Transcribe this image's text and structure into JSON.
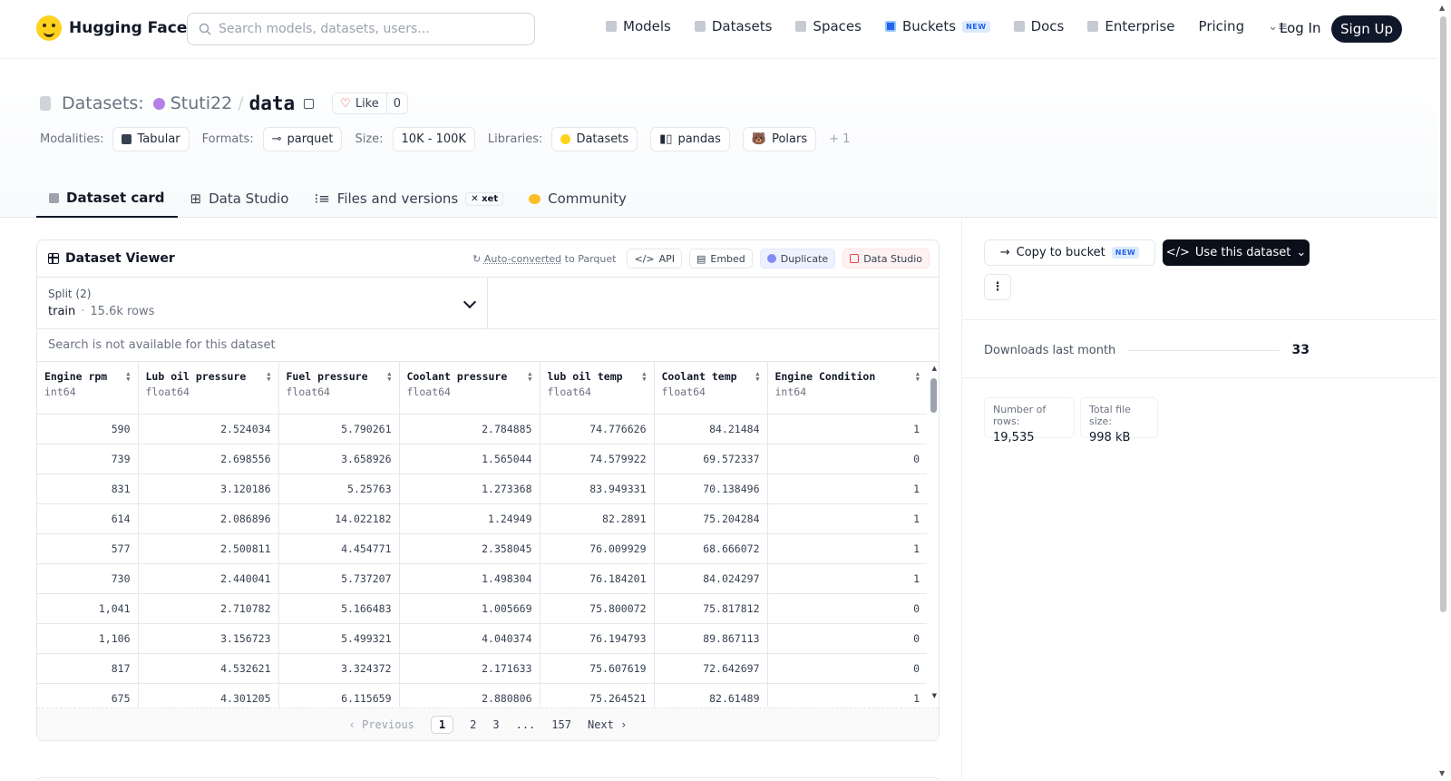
{
  "header": {
    "brand": "Hugging Face",
    "search_placeholder": "Search models, datasets, users...",
    "nav": [
      {
        "label": "Models",
        "icon": "cube-icon"
      },
      {
        "label": "Datasets",
        "icon": "database-icon"
      },
      {
        "label": "Spaces",
        "icon": "grid-icon"
      },
      {
        "label": "Buckets",
        "icon": "bucket-icon",
        "badge": "NEW"
      },
      {
        "label": "Docs",
        "icon": "book-icon"
      },
      {
        "label": "Enterprise",
        "icon": "building-icon"
      },
      {
        "label": "Pricing"
      }
    ],
    "login": "Log In",
    "signup": "Sign Up"
  },
  "dataset": {
    "prefix": "Datasets:",
    "owner": "Stuti22",
    "slash": "/",
    "name": "data",
    "like_label": "Like",
    "like_count": "0",
    "modalities_label": "Modalities:",
    "modality": "Tabular",
    "formats_label": "Formats:",
    "format": "parquet",
    "size_label": "Size:",
    "size": "10K - 100K",
    "libraries_label": "Libraries:",
    "libraries": [
      "Datasets",
      "pandas",
      "Polars"
    ],
    "more_libraries": "+ 1"
  },
  "tabs": {
    "card": "Dataset card",
    "studio": "Data Studio",
    "files": "Files and versions",
    "xet": "xet",
    "community": "Community"
  },
  "viewer": {
    "title": "Dataset Viewer",
    "autoconv_link": "Auto-converted",
    "autoconv_rest": " to Parquet",
    "api": "API",
    "embed": "Embed",
    "duplicate": "Duplicate",
    "data_studio": "Data Studio",
    "split_label": "Split (2)",
    "split_value": "train",
    "split_sep": "·",
    "split_rows": "15.6k rows",
    "search_na": "Search is not available for this dataset",
    "columns": [
      {
        "name": "Engine rpm",
        "dtype": "int64"
      },
      {
        "name": "Lub oil pressure",
        "dtype": "float64"
      },
      {
        "name": "Fuel pressure",
        "dtype": "float64"
      },
      {
        "name": "Coolant pressure",
        "dtype": "float64"
      },
      {
        "name": "lub oil temp",
        "dtype": "float64"
      },
      {
        "name": "Coolant temp",
        "dtype": "float64"
      },
      {
        "name": "Engine Condition",
        "dtype": "int64"
      }
    ],
    "rows": [
      [
        "590",
        "2.524034",
        "5.790261",
        "2.784885",
        "74.776626",
        "84.21484",
        "1"
      ],
      [
        "739",
        "2.698556",
        "3.658926",
        "1.565044",
        "74.579922",
        "69.572337",
        "0"
      ],
      [
        "831",
        "3.120186",
        "5.25763",
        "1.273368",
        "83.949331",
        "70.138496",
        "1"
      ],
      [
        "614",
        "2.086896",
        "14.022182",
        "1.24949",
        "82.2891",
        "75.204284",
        "1"
      ],
      [
        "577",
        "2.500811",
        "4.454771",
        "2.358045",
        "76.009929",
        "68.666072",
        "1"
      ],
      [
        "730",
        "2.440041",
        "5.737207",
        "1.498304",
        "76.184201",
        "84.024297",
        "1"
      ],
      [
        "1,041",
        "2.710782",
        "5.166483",
        "1.005669",
        "75.800072",
        "75.817812",
        "0"
      ],
      [
        "1,106",
        "3.156723",
        "5.499321",
        "4.040374",
        "76.194793",
        "89.867113",
        "0"
      ],
      [
        "817",
        "4.532621",
        "3.324372",
        "2.171633",
        "75.607619",
        "72.642697",
        "0"
      ],
      [
        "675",
        "4.301205",
        "6.115659",
        "2.880806",
        "75.264521",
        "82.61489",
        "1"
      ]
    ],
    "pager": {
      "prev": "Previous",
      "pages": [
        "1",
        "2",
        "3",
        "...",
        "157"
      ],
      "next": "Next"
    }
  },
  "sidebar": {
    "copy_bucket": "Copy to bucket",
    "copy_badge": "NEW",
    "use_dataset": "Use this dataset",
    "downloads_label": "Downloads last month",
    "downloads": "33",
    "rows_label": "Number of rows:",
    "rows": "19,535",
    "filesize_label": "Total file size:",
    "filesize": "998 kB"
  }
}
